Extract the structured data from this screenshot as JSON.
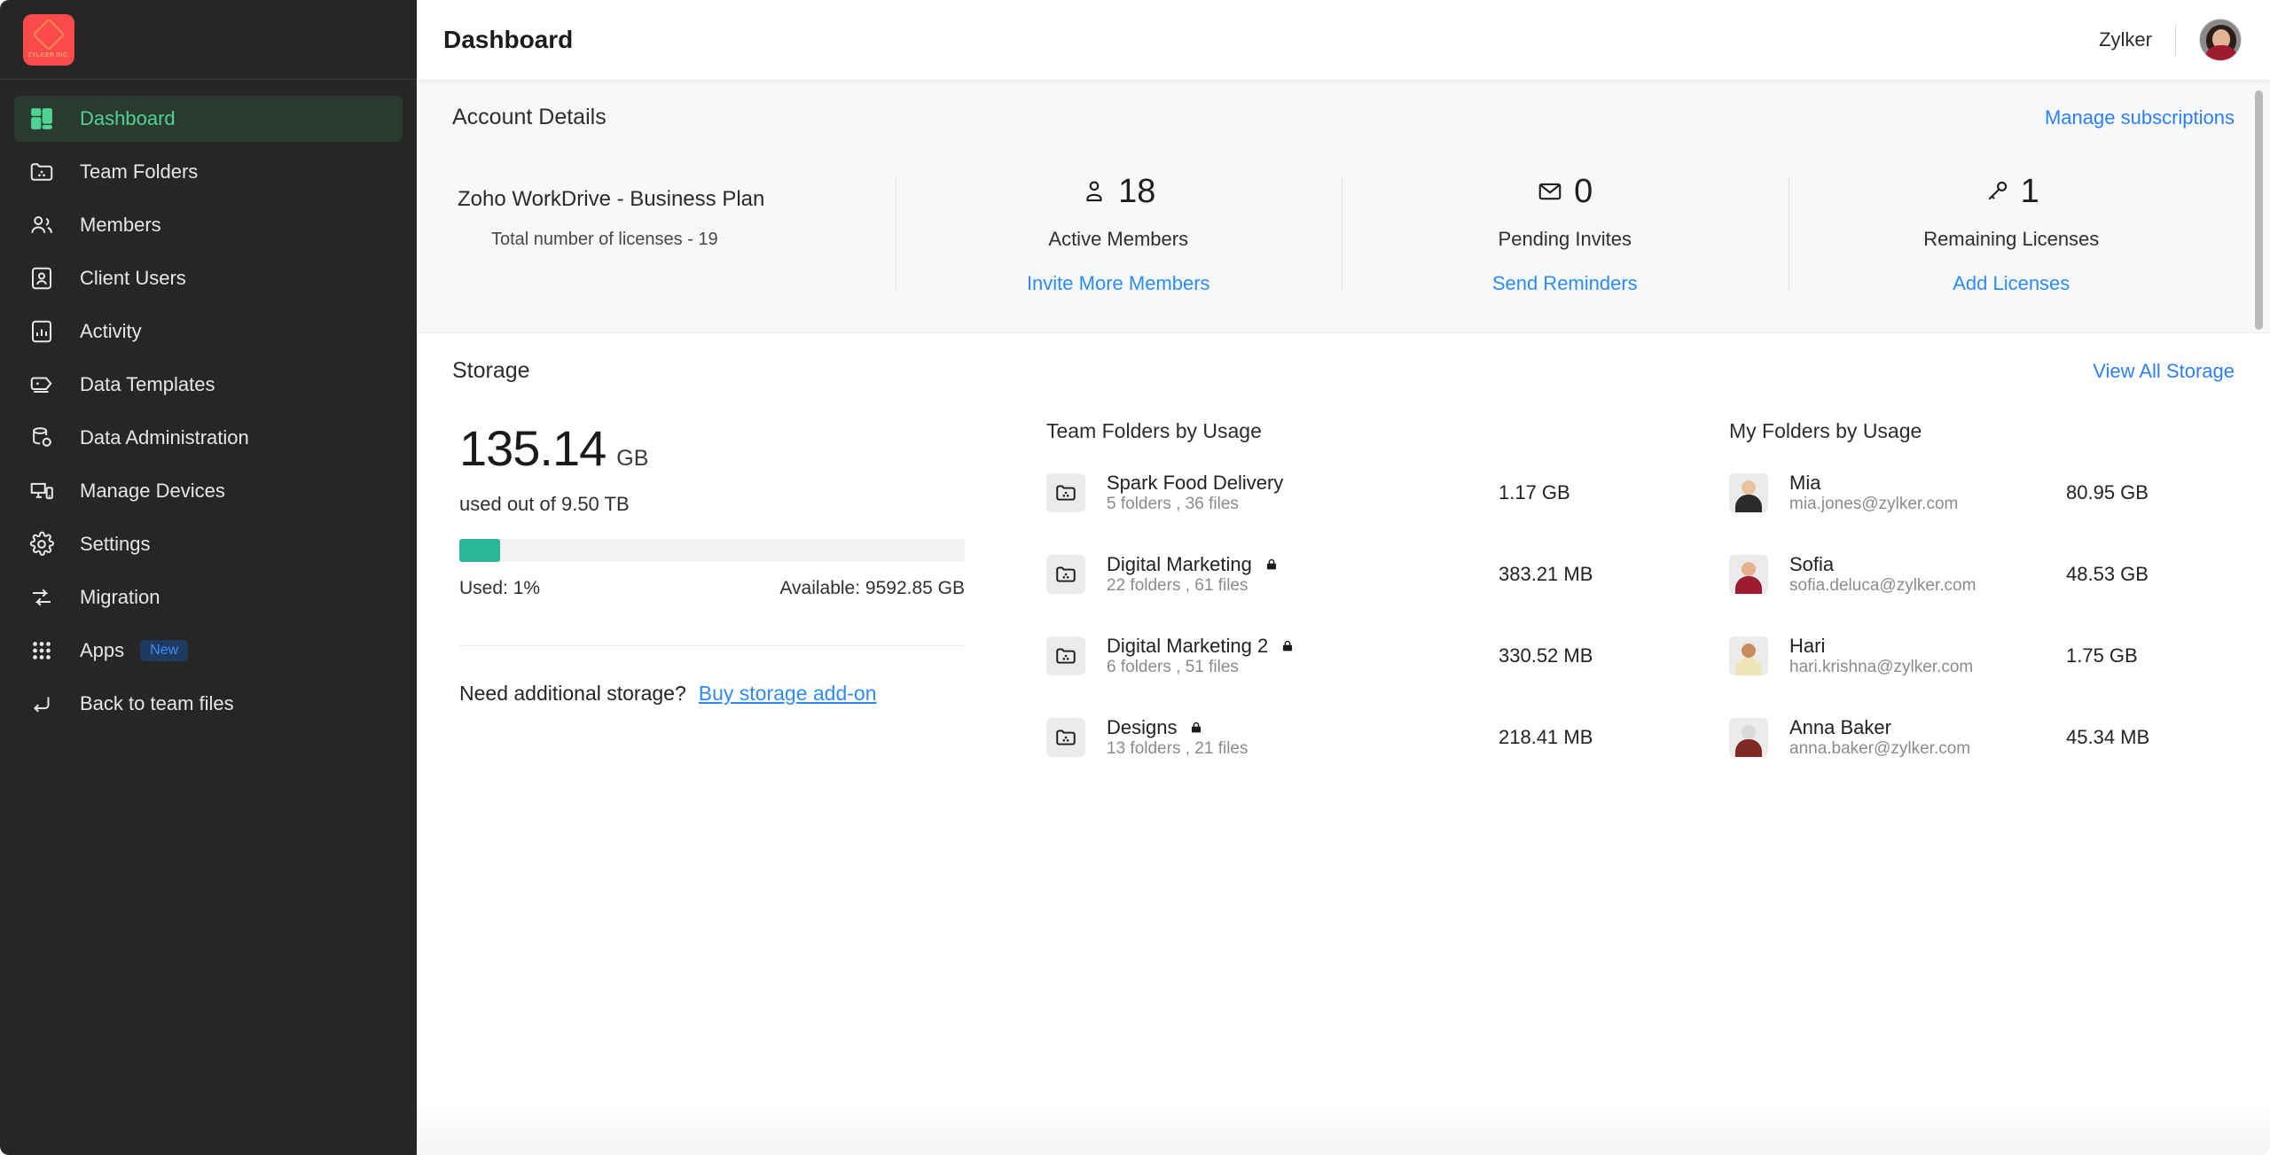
{
  "sidebar": {
    "logo": {
      "label": "ZYLKER INC."
    },
    "items": [
      {
        "label": "Dashboard",
        "icon": "dashboard-grid-icon",
        "active": true
      },
      {
        "label": "Team Folders",
        "icon": "folder-shared-icon",
        "active": false
      },
      {
        "label": "Members",
        "icon": "people-icon",
        "active": false
      },
      {
        "label": "Client Users",
        "icon": "contact-card-icon",
        "active": false
      },
      {
        "label": "Activity",
        "icon": "activity-chart-icon",
        "active": false
      },
      {
        "label": "Data Templates",
        "icon": "template-tag-icon",
        "active": false
      },
      {
        "label": "Data Administration",
        "icon": "database-gear-icon",
        "active": false
      },
      {
        "label": "Manage Devices",
        "icon": "devices-icon",
        "active": false
      },
      {
        "label": "Settings",
        "icon": "gear-icon",
        "active": false
      },
      {
        "label": "Migration",
        "icon": "migration-arrows-icon",
        "active": false
      },
      {
        "label": "Apps",
        "icon": "grid-dots-icon",
        "badge": "New",
        "active": false
      },
      {
        "label": "Back to team files",
        "icon": "return-arrow-icon",
        "active": false
      }
    ]
  },
  "topbar": {
    "title": "Dashboard",
    "org": "Zylker",
    "avatar_name": "user-avatar"
  },
  "account": {
    "title": "Account Details",
    "manage_link": "Manage subscriptions",
    "plan_name": "Zoho WorkDrive - Business Plan",
    "plan_sub": "Total number of licenses - 19",
    "metrics": [
      {
        "icon": "person-icon",
        "value": "18",
        "label": "Active Members",
        "link": "Invite More Members"
      },
      {
        "icon": "envelope-icon",
        "value": "0",
        "label": "Pending Invites",
        "link": "Send Reminders"
      },
      {
        "icon": "key-icon",
        "value": "1",
        "label": "Remaining Licenses",
        "link": "Add Licenses"
      }
    ]
  },
  "storage": {
    "title": "Storage",
    "view_all_link": "View All Storage",
    "used_value": "135.14",
    "used_unit": "GB",
    "used_out_of": "used out of 9.50 TB",
    "percent_used_fill": 8,
    "used_label": "Used: 1%",
    "available_label": "Available: 9592.85 GB",
    "addon_question": "Need additional storage?",
    "addon_link": "Buy storage add-on",
    "team_folders": {
      "title": "Team Folders by Usage",
      "rows": [
        {
          "name": "Spark Food Delivery",
          "locked": false,
          "sub": "5 folders , 36 files",
          "size": "1.17 GB"
        },
        {
          "name": "Digital Marketing",
          "locked": true,
          "sub": "22 folders , 61 files",
          "size": "383.21 MB"
        },
        {
          "name": "Digital Marketing 2",
          "locked": true,
          "sub": "6 folders , 51 files",
          "size": "330.52 MB"
        },
        {
          "name": "Designs",
          "locked": true,
          "sub": "13 folders , 21 files",
          "size": "218.41 MB"
        }
      ]
    },
    "my_folders": {
      "title": "My Folders by Usage",
      "rows": [
        {
          "name": "Mia",
          "sub": "mia.jones@zylker.com",
          "size": "80.95 GB",
          "tone": "p-mia"
        },
        {
          "name": "Sofia",
          "sub": "sofia.deluca@zylker.com",
          "size": "48.53 GB",
          "tone": "p-sofia"
        },
        {
          "name": "Hari",
          "sub": "hari.krishna@zylker.com",
          "size": "1.75 GB",
          "tone": "p-hari"
        },
        {
          "name": "Anna Baker",
          "sub": "anna.baker@zylker.com",
          "size": "45.34 MB",
          "tone": "p-anna"
        }
      ]
    }
  },
  "colors": {
    "sidebar_bg": "#262626",
    "active_green": "#4fd393",
    "link_blue": "#2e8bf5",
    "progress_green": "#2bb795",
    "brand_red": "#fb4a4a"
  }
}
